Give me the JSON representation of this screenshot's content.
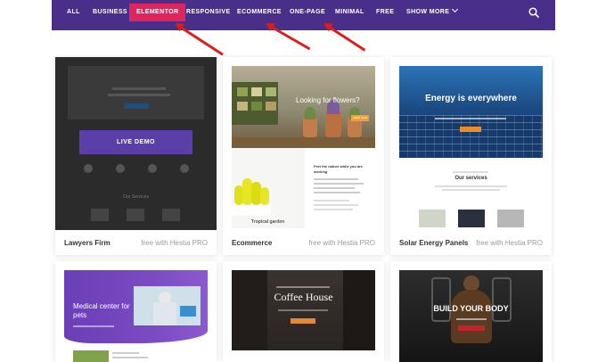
{
  "nav": {
    "items": [
      {
        "label": "ALL",
        "active": false
      },
      {
        "label": "BUSINESS",
        "active": false
      },
      {
        "label": "ELEMENTOR",
        "active": true
      },
      {
        "label": "RESPONSIVE",
        "active": false
      },
      {
        "label": "ECOMMERCE",
        "active": false
      },
      {
        "label": "ONE-PAGE",
        "active": false
      },
      {
        "label": "MINIMAL",
        "active": false
      },
      {
        "label": "FREE",
        "active": false
      },
      {
        "label": "SHOW MORE",
        "active": false
      }
    ],
    "search_icon": "search-icon",
    "chevron_icon": "chevron-down-icon"
  },
  "colors": {
    "nav_bg": "#4a2f8a",
    "active_bg": "#e0245e",
    "arrow": "#e11b1b",
    "live_demo_bg": "#5b3fa8"
  },
  "cards": [
    {
      "title": "Lawyers Firm",
      "meta": "free with Hestia PRO",
      "overlay_button": "LIVE DEMO",
      "preview": {
        "section": "Our Services"
      }
    },
    {
      "title": "Ecommerce",
      "meta": "free with Hestia PRO",
      "preview": {
        "hero": "Looking for flowers?",
        "cta": "SHOP NOW",
        "feature_heading": "Feel the nature while you are working",
        "caption": "Tropical garden"
      }
    },
    {
      "title": "Solar Energy Panels",
      "meta": "free with Hestia PRO",
      "preview": {
        "hero": "Energy is everywhere",
        "section": "Our services"
      }
    },
    {
      "preview": {
        "hero": "Medical center for pets"
      }
    },
    {
      "preview": {
        "hero": "Coffee House"
      }
    },
    {
      "preview": {
        "hero": "BUILD YOUR BODY"
      }
    }
  ]
}
